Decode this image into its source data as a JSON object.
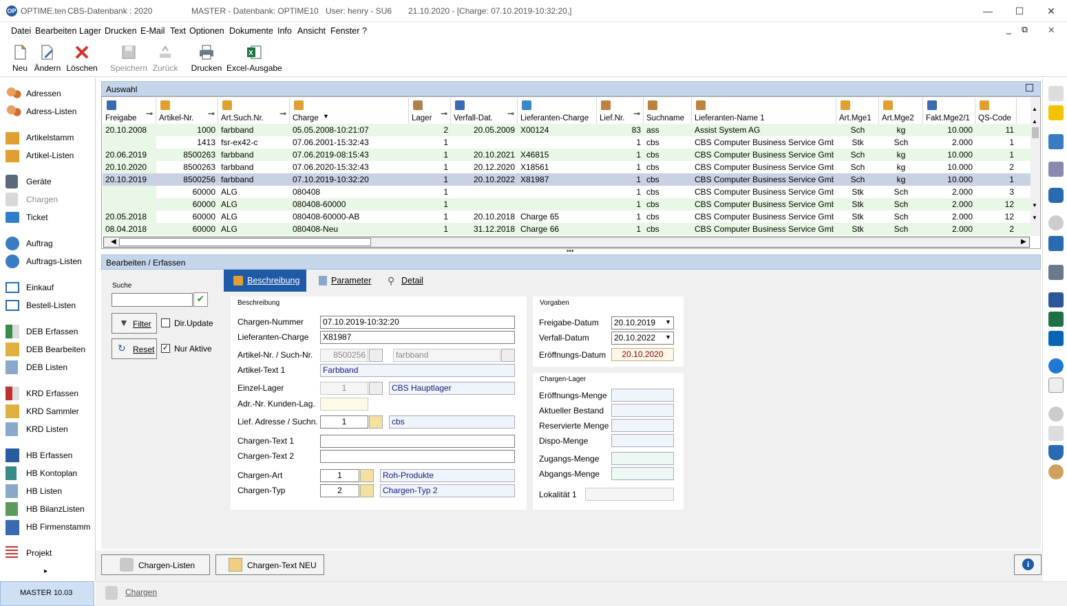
{
  "window": {
    "app": "OPTIME.ten",
    "db_label": "CBS-Datenbank : 2020",
    "master_db": "MASTER - Datenbank:  OPTIME10",
    "user": "User:  henry  -  SU6",
    "date_info": "21.10.2020  -  [Charge: 07.10.2019-10:32:20,]",
    "logo": "OP"
  },
  "menu": [
    "Datei",
    "Bearbeiten",
    "Lager",
    "Drucken",
    "E-Mail",
    "Text",
    "Optionen",
    "Dokumente",
    "Info",
    "Ansicht",
    "Fenster",
    "?"
  ],
  "toolbar": {
    "neu": "Neu",
    "aendern": "Ändern",
    "loeschen": "Löschen",
    "speichern": "Speichern",
    "zurueck": "Zurück",
    "drucken": "Drucken",
    "excel": "Excel-Ausgabe"
  },
  "nav": {
    "adressen": "Adressen",
    "adress_listen": "Adress-Listen",
    "artikelstamm": "Artikelstamm",
    "artikel_listen": "Artikel-Listen",
    "geraete": "Geräte",
    "chargen": "Chargen",
    "ticket": "Ticket",
    "auftrag": "Auftrag",
    "auftrags_listen": "Auftrags-Listen",
    "einkauf": "Einkauf",
    "bestell_listen": "Bestell-Listen",
    "deb_erfassen": "DEB Erfassen",
    "deb_bearbeiten": "DEB Bearbeiten",
    "deb_listen": "DEB Listen",
    "krd_erfassen": "KRD Erfassen",
    "krd_sammler": "KRD Sammler",
    "krd_listen": "KRD Listen",
    "hb_erfassen": "HB Erfassen",
    "hb_kontoplan": "HB Kontoplan",
    "hb_listen": "HB Listen",
    "hb_bilanzlisten": "HB BilanzListen",
    "hb_firmenstamm": "HB Firmenstamm",
    "projekt": "Projekt",
    "more": "▸"
  },
  "master_version": "MASTER   10.03",
  "auswahl": {
    "title": "Auswahl",
    "columns": [
      "Freigabe",
      "Artikel-Nr.",
      "Art.Such.Nr.",
      "Charge",
      "Lager",
      "Verfall-Dat.",
      "Lieferanten-Charge",
      "Lief.Nr.",
      "Suchname",
      "Lieferanten-Name 1",
      "Art.Mge1",
      "Art.Mge2",
      "Fakt.Mge2/1",
      "QS-Code"
    ],
    "rows": [
      [
        "20.10.2008",
        "1000",
        "farbband",
        "05.05.2008-10:21:07",
        "2",
        "20.05.2009",
        "X00124",
        "83",
        "ass",
        "Assist System AG",
        "Sch",
        "kg",
        "10.000",
        "11"
      ],
      [
        "",
        "1413",
        "fsr-ex42-c",
        "07.06.2001-15:32:43",
        "1",
        "",
        "",
        "1",
        "cbs",
        "CBS Computer Business Service GmbH",
        "Stk",
        "Sch",
        "2.000",
        "1"
      ],
      [
        "20.06.2019",
        "8500263",
        "farbband",
        "07.06.2019-08:15:43",
        "1",
        "20.10.2021",
        "X46815",
        "1",
        "cbs",
        "CBS Computer Business Service GmbH",
        "Sch",
        "kg",
        "10.000",
        "1"
      ],
      [
        "20.10.2020",
        "8500263",
        "farbband",
        "07.06.2020-15:32:43",
        "1",
        "20.12.2020",
        "X18561",
        "1",
        "cbs",
        "CBS Computer Business Service GmbH",
        "Sch",
        "kg",
        "10.000",
        "2"
      ],
      [
        "20.10.2019",
        "8500256",
        "farbband",
        "07.10.2019-10:32:20",
        "1",
        "20.10.2022",
        "X81987",
        "1",
        "cbs",
        "CBS Computer Business Service GmbH",
        "Sch",
        "kg",
        "10.000",
        "1"
      ],
      [
        "",
        "60000",
        "ALG",
        "080408",
        "1",
        "",
        "",
        "1",
        "cbs",
        "CBS Computer Business Service GmbH",
        "Stk",
        "Sch",
        "2.000",
        "3"
      ],
      [
        "",
        "60000",
        "ALG",
        "080408-60000",
        "1",
        "",
        "",
        "1",
        "cbs",
        "CBS Computer Business Service GmbH",
        "Stk",
        "Sch",
        "2.000",
        "12"
      ],
      [
        "20.05.2018",
        "60000",
        "ALG",
        "080408-60000-AB",
        "1",
        "20.10.2018",
        "Charge 65",
        "1",
        "cbs",
        "CBS Computer Business Service GmbH",
        "Stk",
        "Sch",
        "2.000",
        "12"
      ],
      [
        "08.04.2018",
        "60000",
        "ALG",
        "080408-Neu",
        "1",
        "31.12.2018",
        "Charge 66",
        "1",
        "cbs",
        "CBS Computer Business Service GmbH",
        "Stk",
        "Sch",
        "2.000",
        "2"
      ]
    ],
    "selected_row": 4
  },
  "bearbeiten": {
    "title": "Bearbeiten / Erfassen",
    "suche_label": "Suche",
    "suche_value": "",
    "filter": "Filter",
    "reset": "Reset",
    "dir_update": "Dir.Update",
    "nur_aktive": "Nur Aktive",
    "nur_aktive_checked": true,
    "tabs": [
      "Beschreibung",
      "Parameter",
      "Detail"
    ],
    "beschreibung": {
      "group": "Beschreibung",
      "chargen_nummer_label": "Chargen-Nummer",
      "chargen_nummer": "07.10.2019-10:32:20",
      "lieferanten_charge_label": "Lieferanten-Charge",
      "lieferanten_charge": "X81987",
      "artikel_nr_label": "Artikel-Nr. / Such-Nr.",
      "artikel_nr": "8500256",
      "such_nr": "farbband",
      "artikel_text_label": "Artikel-Text 1",
      "artikel_text": "Farbband",
      "einzel_lager_label": "Einzel-Lager",
      "einzel_lager": "1",
      "einzel_lager_name": "CBS Hauptlager",
      "adr_nr_label": "Adr.-Nr. Kunden-Lag.",
      "adr_nr": "",
      "lief_adresse_label": "Lief. Adresse / Suchn.",
      "lief_adresse": "1",
      "lief_suchname": "cbs",
      "chargen_text1_label": "Chargen-Text 1",
      "chargen_text1": "",
      "chargen_text2_label": "Chargen-Text 2",
      "chargen_text2": "",
      "chargen_art_label": "Chargen-Art",
      "chargen_art": "1",
      "chargen_art_name": "Roh-Produkte",
      "chargen_typ_label": "Chargen-Typ",
      "chargen_typ": "2",
      "chargen_typ_name": "Chargen-Typ 2"
    },
    "vorgaben": {
      "group": "Vorgaben",
      "freigabe_label": "Freigabe-Datum",
      "freigabe": "20.10.2019",
      "verfall_label": "Verfall-Datum",
      "verfall": "20.10.2022",
      "eroeffnung_label": "Eröffnungs-Datum",
      "eroeffnung": "20.10.2020"
    },
    "chargen_lager": {
      "group": "Chargen-Lager",
      "labels": [
        "Eröffnungs-Menge",
        "Aktueller Bestand",
        "Reservierte Menge",
        "Dispo-Menge",
        "Zugangs-Menge",
        "Abgangs-Menge",
        "Lokalität 1"
      ]
    }
  },
  "bottom": {
    "chargen_listen": "Chargen-Listen",
    "chargen_text_neu": "Chargen-Text NEU",
    "info": "i"
  },
  "status": {
    "chargen": "Chargen"
  },
  "colors": {
    "header_blue": "#c5d5ea",
    "row_green": "#e9f7e6",
    "row_selected": "#c9d1e3",
    "accent": "#2a5aa0"
  }
}
